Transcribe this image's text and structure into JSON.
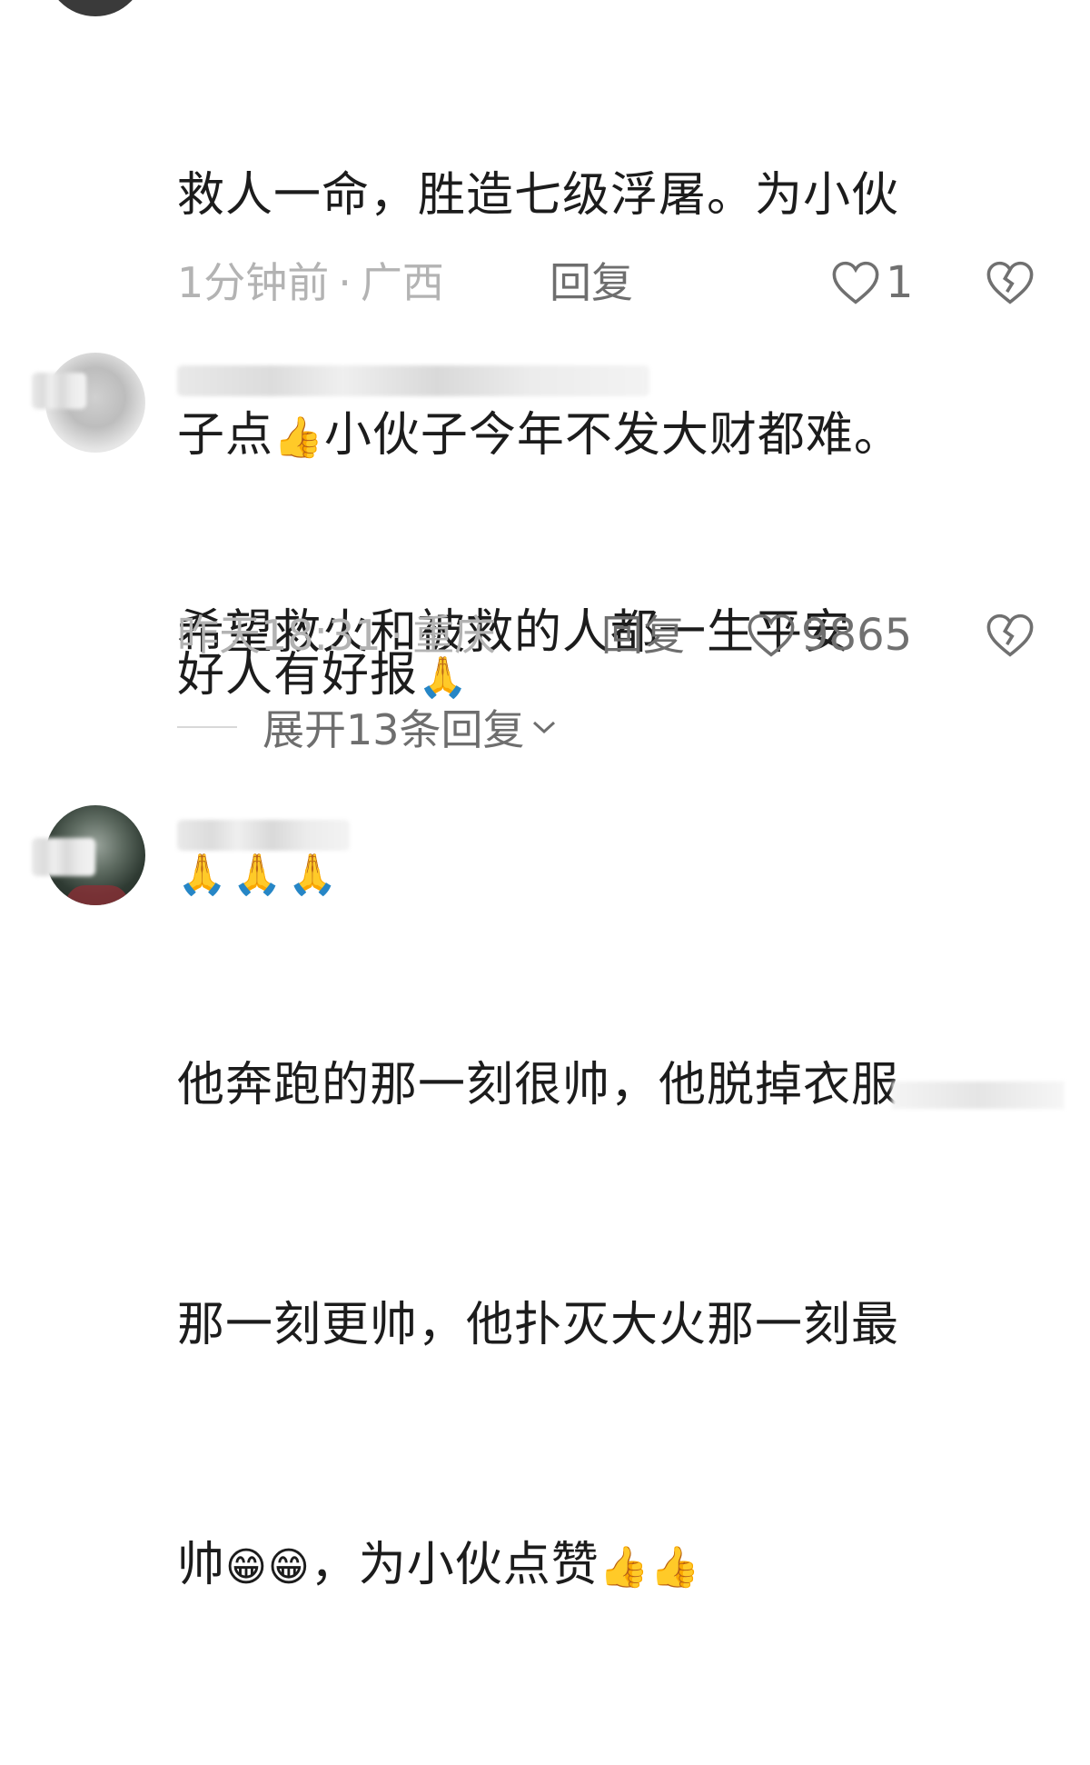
{
  "comments": [
    {
      "text_line1": "救人一命，胜造七级浮屠。为小伙",
      "text_line2a": "子点",
      "text_emoji1": "👍",
      "text_line2b": "小伙子今年不发大财都难。",
      "text_line3": "好人有好报",
      "text_emoji2": "🙏",
      "time": "1分钟前",
      "location": "广西",
      "separator": "·",
      "reply_label": "回复",
      "likes": "1",
      "icons": {
        "like": "heart-outline-icon",
        "dislike": "broken-heart-icon"
      }
    },
    {
      "text_line1": "希望救火和被救的人都一生平安",
      "text_emojis": "🙏🙏🙏",
      "time": "昨天18:31",
      "location": "重庆",
      "separator": "·",
      "reply_label": "回复",
      "likes": "9865",
      "expand_label": "展开13条回复",
      "icons": {
        "like": "heart-outline-icon",
        "dislike": "broken-heart-icon",
        "expand": "chevron-down-icon"
      }
    },
    {
      "text_line1": "他奔跑的那一刻很帅，他脱掉衣服",
      "text_line2": "那一刻更帅，他扑灭大火那一刻最",
      "text_line3a": "帅",
      "text_emoji1": "😁😁",
      "text_line3b": "，为小伙点赞",
      "text_emoji2": "👍👍"
    }
  ],
  "colors": {
    "primary_text": "#1c1c1c",
    "meta_text": "#b3b3b3",
    "action_text": "#6e6e6e"
  }
}
